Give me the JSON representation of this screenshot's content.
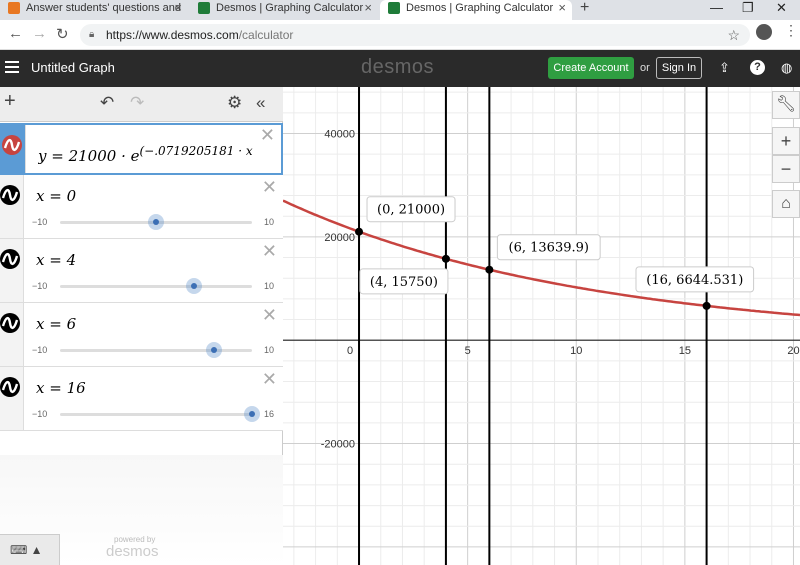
{
  "browser": {
    "tabs": [
      {
        "title": "Answer students' questions and",
        "favicon": "chegg-icon",
        "color": "#e87722"
      },
      {
        "title": "Desmos | Graphing Calculator",
        "favicon": "desmos-icon",
        "color": "#1f7c39"
      },
      {
        "title": "Desmos | Graphing Calculator",
        "favicon": "desmos-icon",
        "color": "#1f7c39"
      }
    ],
    "url_host": "https://www.desmos.com",
    "url_path": "/calculator"
  },
  "header": {
    "title": "Untitled Graph",
    "logo": "desmos",
    "create_account": "Create Account",
    "or": "or",
    "sign_in": "Sign In"
  },
  "expressions": [
    {
      "latex": "y = 21000 · e",
      "exponent": "(−.0719205181 · x"
    },
    {
      "latex": "x = 0",
      "min": "−10",
      "max": "10",
      "value": 0,
      "range": [
        -10,
        10
      ]
    },
    {
      "latex": "x = 4",
      "min": "−10",
      "max": "10",
      "value": 4,
      "range": [
        -10,
        10
      ]
    },
    {
      "latex": "x = 6",
      "min": "−10",
      "max": "10",
      "value": 6,
      "range": [
        -10,
        10
      ]
    },
    {
      "latex": "x = 16",
      "min": "−10",
      "max": "16",
      "value": 16,
      "range": [
        -10,
        16
      ]
    }
  ],
  "footer": {
    "powered_by": "powered by",
    "logo": "desmos"
  },
  "graph": {
    "x_range": [
      -3.5,
      20.3
    ],
    "y_range": [
      -43500,
      49000
    ],
    "x_ticks": [
      {
        "v": 0,
        "label": "0"
      },
      {
        "v": 5,
        "label": "5"
      },
      {
        "v": 10,
        "label": "10"
      },
      {
        "v": 15,
        "label": "15"
      },
      {
        "v": 20,
        "label": "20"
      }
    ],
    "y_ticks": [
      {
        "v": 40000,
        "label": "40000"
      },
      {
        "v": 20000,
        "label": "20000"
      },
      {
        "v": -20000,
        "label": "-20000"
      }
    ],
    "curve": {
      "a": 21000,
      "k": -0.0719205181,
      "color": "#c74440"
    },
    "vertical_lines": [
      0,
      4,
      6,
      16
    ],
    "points": [
      {
        "x": 0,
        "y": 21000,
        "label": "(0, 21000)",
        "anchor": "above-right"
      },
      {
        "x": 4,
        "y": 15750,
        "label": "(4, 15750)",
        "anchor": "below-left"
      },
      {
        "x": 6,
        "y": 13639.9,
        "label": "(6, 13639.9)",
        "anchor": "above-right"
      },
      {
        "x": 16,
        "y": 6644.531,
        "label": "(16, 6644.531)",
        "anchor": "above-left"
      }
    ]
  }
}
